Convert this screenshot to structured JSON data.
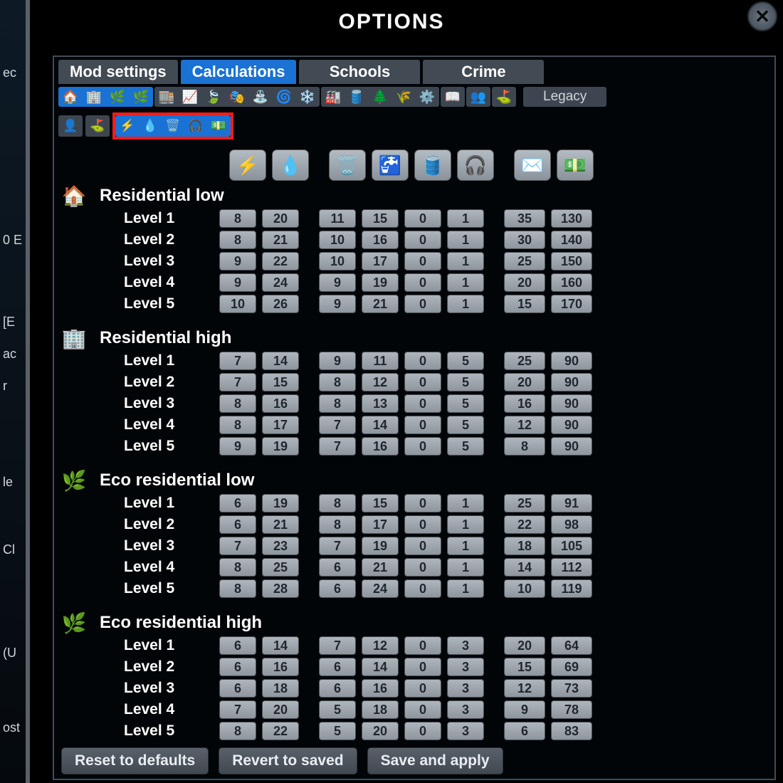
{
  "title": "OPTIONS",
  "tabs": [
    "Mod settings",
    "Calculations",
    "Schools",
    "Crime"
  ],
  "active_tab": 1,
  "legacy_label": "Legacy",
  "left_fragments": [
    "ec",
    "0 E",
    "[E",
    "ac",
    "r",
    "le",
    "Cl",
    "(U",
    "ost"
  ],
  "column_icons": [
    "⚡",
    "💧",
    "🗑️",
    "🚰",
    "🛢️",
    "🎧",
    "✉️",
    "💵"
  ],
  "categories": [
    {
      "name": "Residential low",
      "icon": "🏠",
      "icon_color": "#27cc3e",
      "rows": [
        {
          "label": "Level 1",
          "v": [
            8,
            20,
            11,
            15,
            0,
            1,
            35,
            130
          ]
        },
        {
          "label": "Level 2",
          "v": [
            8,
            21,
            10,
            16,
            0,
            1,
            30,
            140
          ]
        },
        {
          "label": "Level 3",
          "v": [
            9,
            22,
            10,
            17,
            0,
            1,
            25,
            150
          ]
        },
        {
          "label": "Level 4",
          "v": [
            9,
            24,
            9,
            19,
            0,
            1,
            20,
            160
          ]
        },
        {
          "label": "Level 5",
          "v": [
            10,
            26,
            9,
            21,
            0,
            1,
            15,
            170
          ]
        }
      ]
    },
    {
      "name": "Residential high",
      "icon": "🏢",
      "icon_color": "#27cc3e",
      "rows": [
        {
          "label": "Level 1",
          "v": [
            7,
            14,
            9,
            11,
            0,
            5,
            25,
            90
          ]
        },
        {
          "label": "Level 2",
          "v": [
            7,
            15,
            8,
            12,
            0,
            5,
            20,
            90
          ]
        },
        {
          "label": "Level 3",
          "v": [
            8,
            16,
            8,
            13,
            0,
            5,
            16,
            90
          ]
        },
        {
          "label": "Level 4",
          "v": [
            8,
            17,
            7,
            14,
            0,
            5,
            12,
            90
          ]
        },
        {
          "label": "Level 5",
          "v": [
            9,
            19,
            7,
            16,
            0,
            5,
            8,
            90
          ]
        }
      ]
    },
    {
      "name": "Eco residential low",
      "icon": "🌿",
      "icon_color": "#4aa4d8",
      "rows": [
        {
          "label": "Level 1",
          "v": [
            6,
            19,
            8,
            15,
            0,
            1,
            25,
            91
          ]
        },
        {
          "label": "Level 2",
          "v": [
            6,
            21,
            8,
            17,
            0,
            1,
            22,
            98
          ]
        },
        {
          "label": "Level 3",
          "v": [
            7,
            23,
            7,
            19,
            0,
            1,
            18,
            105
          ]
        },
        {
          "label": "Level 4",
          "v": [
            8,
            25,
            6,
            21,
            0,
            1,
            14,
            112
          ]
        },
        {
          "label": "Level 5",
          "v": [
            8,
            28,
            6,
            24,
            0,
            1,
            10,
            119
          ]
        }
      ]
    },
    {
      "name": "Eco residential high",
      "icon": "🌿",
      "icon_color": "#4aa4d8",
      "rows": [
        {
          "label": "Level 1",
          "v": [
            6,
            14,
            7,
            12,
            0,
            3,
            20,
            64
          ]
        },
        {
          "label": "Level 2",
          "v": [
            6,
            16,
            6,
            14,
            0,
            3,
            15,
            69
          ]
        },
        {
          "label": "Level 3",
          "v": [
            6,
            18,
            6,
            16,
            0,
            3,
            12,
            73
          ]
        },
        {
          "label": "Level 4",
          "v": [
            7,
            20,
            5,
            18,
            0,
            3,
            9,
            78
          ]
        },
        {
          "label": "Level 5",
          "v": [
            8,
            22,
            5,
            20,
            0,
            3,
            6,
            83
          ]
        }
      ]
    }
  ],
  "buttons": {
    "reset": "Reset to defaults",
    "revert": "Revert to saved",
    "save": "Save and apply"
  },
  "icon_strip_1": [
    {
      "sel": true,
      "icons": [
        "🏠",
        "🏢",
        "🌿",
        "🌿"
      ]
    },
    {
      "sel": false,
      "icons": [
        "🏬",
        "📈",
        "🍃",
        "🎭",
        "⛲",
        "🌀",
        "❄️"
      ]
    },
    {
      "sel": false,
      "icons": [
        "🏭",
        "🛢️",
        "🌲",
        "🌾",
        "⚙️"
      ]
    },
    {
      "sel": false,
      "icons": [
        "📖"
      ]
    },
    {
      "sel": false,
      "icons": [
        "👥"
      ]
    },
    {
      "sel": false,
      "icons": [
        "⛳"
      ]
    }
  ],
  "icon_strip_2": [
    {
      "sel": false,
      "icons": [
        "👤"
      ]
    },
    {
      "sel": false,
      "icons": [
        "⛳"
      ]
    },
    {
      "sel": true,
      "icons": [
        "⚡",
        "💧",
        "🗑️",
        "🎧",
        "💵"
      ],
      "highlight": true
    }
  ]
}
